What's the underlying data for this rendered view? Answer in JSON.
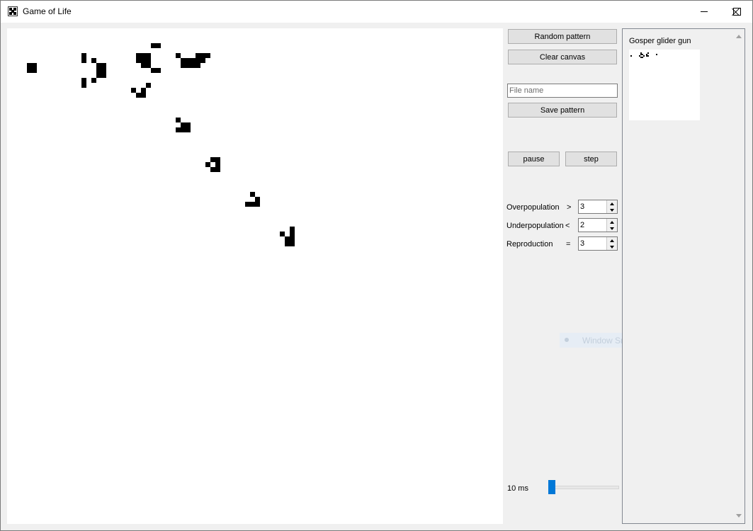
{
  "window": {
    "title": "Game of Life",
    "controls": [
      "minimize",
      "maximize",
      "close"
    ]
  },
  "canvas": {
    "cell_size": 7,
    "live_cells": [
      [
        4,
        7
      ],
      [
        5,
        7
      ],
      [
        4,
        8
      ],
      [
        5,
        8
      ],
      [
        15,
        5
      ],
      [
        15,
        6
      ],
      [
        17,
        6
      ],
      [
        18,
        7
      ],
      [
        19,
        7
      ],
      [
        18,
        8
      ],
      [
        19,
        8
      ],
      [
        18,
        9
      ],
      [
        19,
        9
      ],
      [
        17,
        10
      ],
      [
        15,
        10
      ],
      [
        15,
        11
      ],
      [
        29,
        3
      ],
      [
        30,
        3
      ],
      [
        26,
        5
      ],
      [
        27,
        5
      ],
      [
        26,
        6
      ],
      [
        27,
        6
      ],
      [
        28,
        5
      ],
      [
        28,
        6
      ],
      [
        27,
        7
      ],
      [
        28,
        7
      ],
      [
        29,
        8
      ],
      [
        30,
        8
      ],
      [
        25,
        12
      ],
      [
        26,
        13
      ],
      [
        27,
        13
      ],
      [
        27,
        12
      ],
      [
        28,
        11
      ],
      [
        34,
        5
      ],
      [
        35,
        6
      ],
      [
        36,
        6
      ],
      [
        35,
        7
      ],
      [
        36,
        7
      ],
      [
        37,
        7
      ],
      [
        38,
        7
      ],
      [
        37,
        6
      ],
      [
        38,
        6
      ],
      [
        39,
        6
      ],
      [
        40,
        5
      ],
      [
        39,
        5
      ],
      [
        38,
        5
      ],
      [
        34,
        18
      ],
      [
        35,
        19
      ],
      [
        34,
        20
      ],
      [
        35,
        20
      ],
      [
        36,
        20
      ],
      [
        36,
        19
      ],
      [
        40,
        27
      ],
      [
        41,
        28
      ],
      [
        42,
        27
      ],
      [
        42,
        28
      ],
      [
        41,
        26
      ],
      [
        42,
        26
      ],
      [
        49,
        33
      ],
      [
        50,
        34
      ],
      [
        48,
        35
      ],
      [
        49,
        35
      ],
      [
        50,
        35
      ],
      [
        55,
        41
      ],
      [
        56,
        42
      ],
      [
        57,
        42
      ],
      [
        57,
        41
      ],
      [
        57,
        40
      ],
      [
        56,
        43
      ],
      [
        57,
        43
      ]
    ]
  },
  "controls": {
    "random_label": "Random pattern",
    "clear_label": "Clear canvas",
    "filename_placeholder": "File name",
    "save_label": "Save pattern",
    "pause_label": "pause",
    "step_label": "step"
  },
  "rules": {
    "overpopulation": {
      "label": "Overpopulation",
      "op": ">",
      "value": "3"
    },
    "underpopulation": {
      "label": "Underpopulation",
      "op": "<",
      "value": "2"
    },
    "reproduction": {
      "label": "Reproduction",
      "op": "=",
      "value": "3"
    }
  },
  "overlay": {
    "label": "Window Snip"
  },
  "speed": {
    "label": "10 ms",
    "slider_fraction": 0.0
  },
  "patterns": [
    {
      "name": "Gosper glider gun"
    }
  ],
  "colors": {
    "accent": "#0078d7",
    "cell": "#000000",
    "canvas": "#ffffff"
  }
}
